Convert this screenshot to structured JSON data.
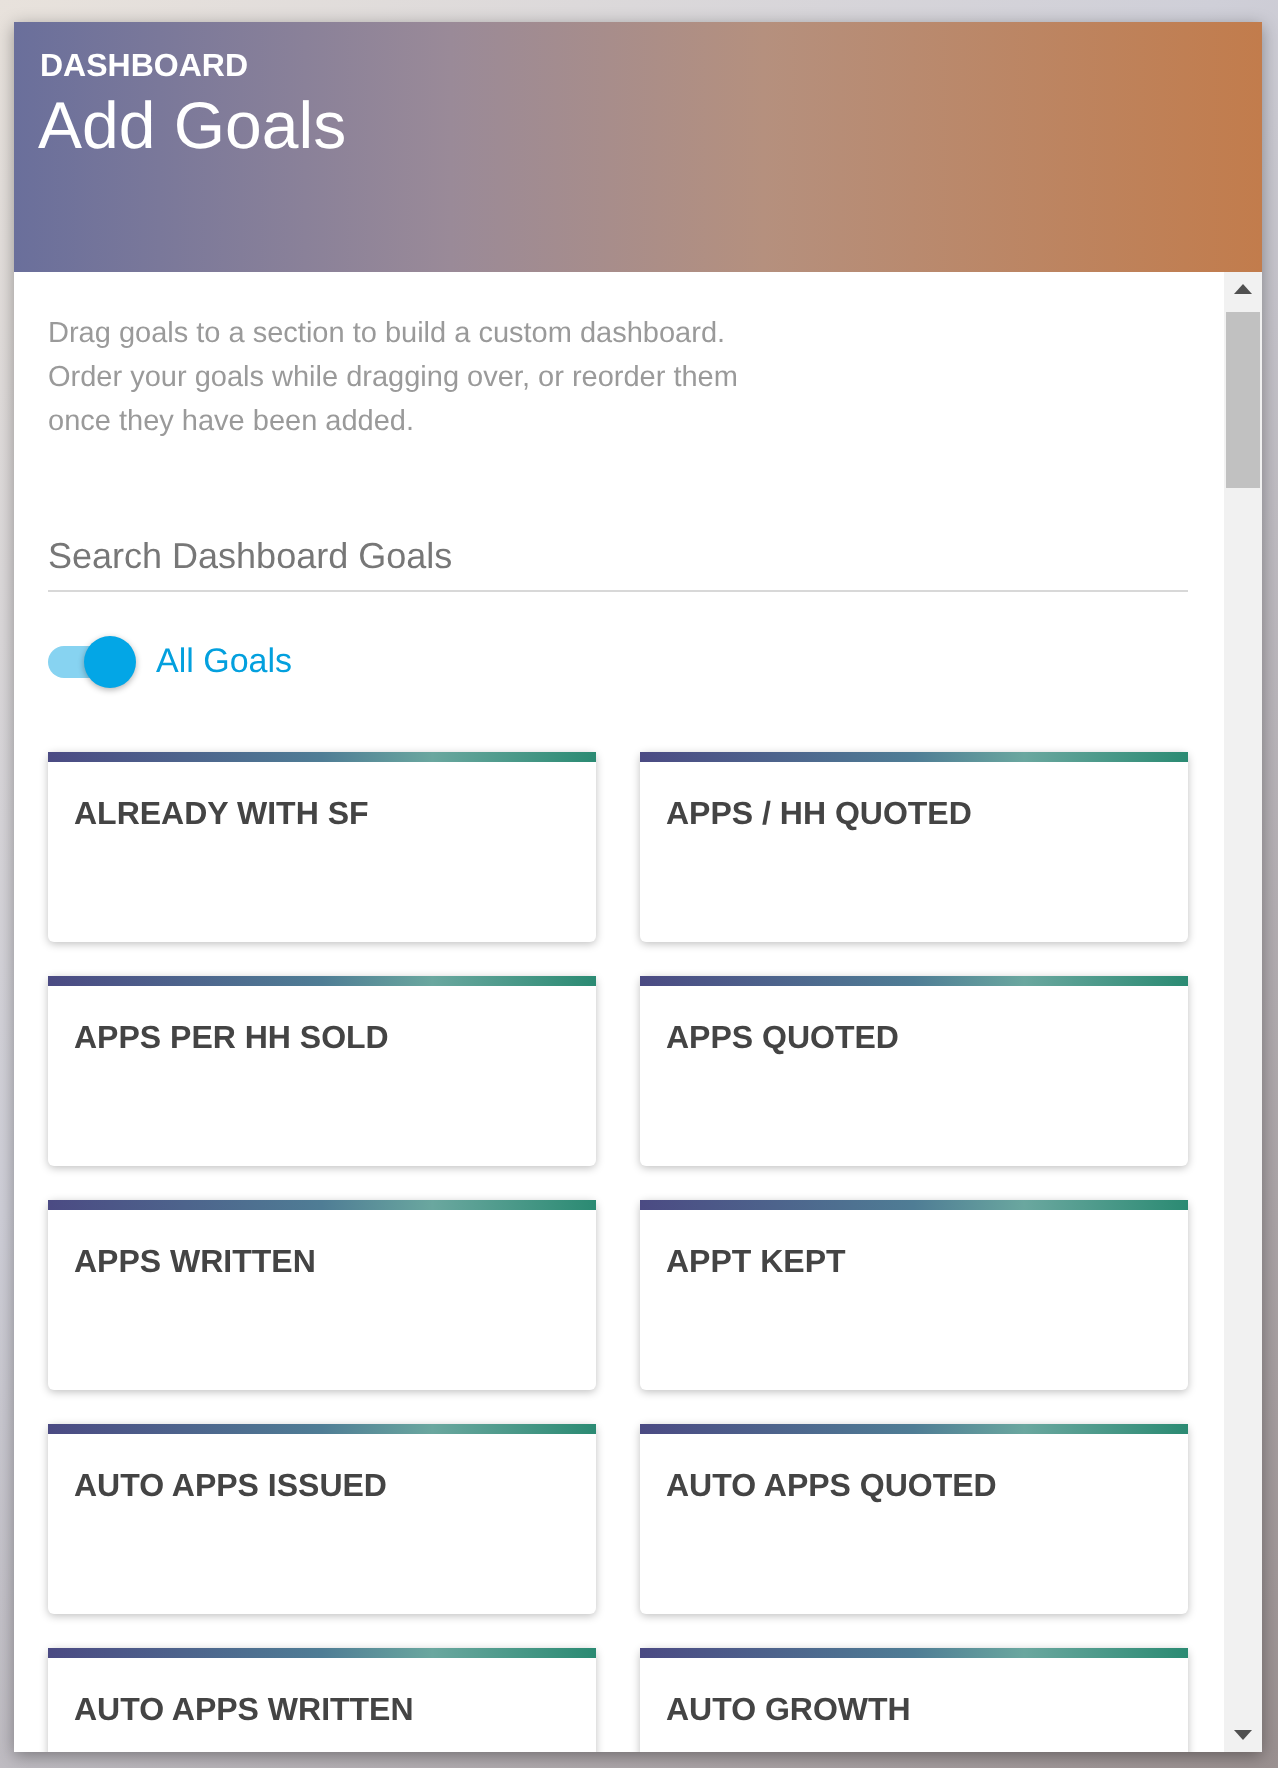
{
  "header": {
    "eyebrow": "DASHBOARD",
    "title": "Add Goals"
  },
  "intro": "Drag goals to a section to build a custom dashboard. Order your goals while dragging over, or reorder them once they have been added.",
  "search": {
    "placeholder": "Search Dashboard Goals"
  },
  "filter_toggle": {
    "label": "All Goals",
    "on": true
  },
  "goals": [
    {
      "name": "ALREADY WITH SF"
    },
    {
      "name": "APPS / HH QUOTED"
    },
    {
      "name": "APPS PER HH SOLD"
    },
    {
      "name": "APPS QUOTED"
    },
    {
      "name": "APPS WRITTEN"
    },
    {
      "name": "APPT KEPT"
    },
    {
      "name": "AUTO APPS ISSUED"
    },
    {
      "name": "AUTO APPS QUOTED"
    },
    {
      "name": "AUTO APPS WRITTEN"
    },
    {
      "name": "AUTO GROWTH"
    }
  ]
}
